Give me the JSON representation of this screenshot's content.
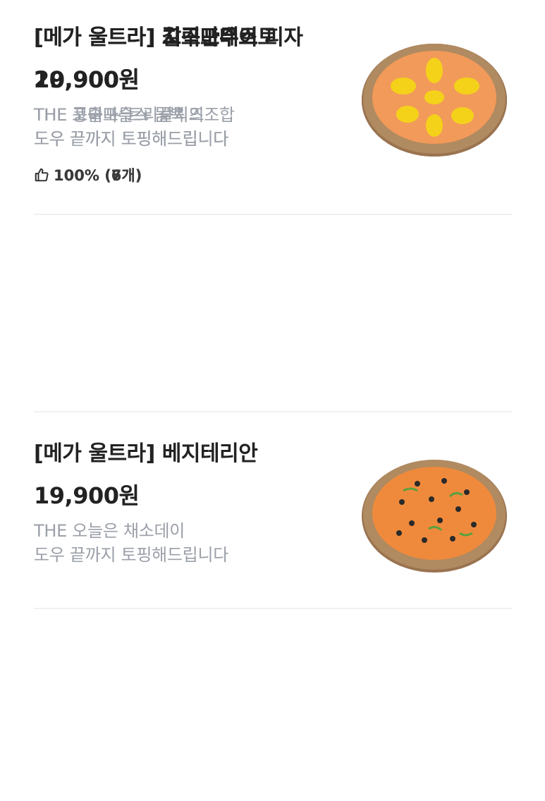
{
  "items": [
    {
      "title": "[메가 울트라] 치즈만수르",
      "price": "19,900원",
      "desc_line1": "THE 풍미 + 트리플치즈",
      "desc_line2": "도우 끝까지 토핑해드립니다",
      "rating": "100% (7개)",
      "image": "cheese-pizza"
    },
    {
      "title": "[메가 울트라] 베지테리안",
      "price": "19,900원",
      "desc_line1": "THE 오늘은 채소데이",
      "desc_line2": "도우 끝까지 토핑해드립니다",
      "image": "vegetarian-pizza"
    },
    {
      "title": "[메가 울트라] 갈릭포테이토",
      "price": "20,900원",
      "desc_line1": "THE 포슬포슬 + 갈릭의조합",
      "desc_line2": "도우 끝까지 토핑해드립니다",
      "image": "garlic-potato-pizza"
    },
    {
      "title": "[메가 울트라] 고구마무스 피자",
      "price": "20,900원",
      "desc_line1": "THE 고구마무스 듬뿍",
      "desc_line2": "도우 끝까지 토핑해드립니다",
      "rating": "100% (6개)",
      "image": "sweet-potato-pizza"
    }
  ],
  "colors": {
    "title": "#222222",
    "desc": "#9a9fa8",
    "divider": "#f0f0f0",
    "crust": "#8a6a4a"
  },
  "icons": {
    "rating": "thumbs-up-icon"
  }
}
